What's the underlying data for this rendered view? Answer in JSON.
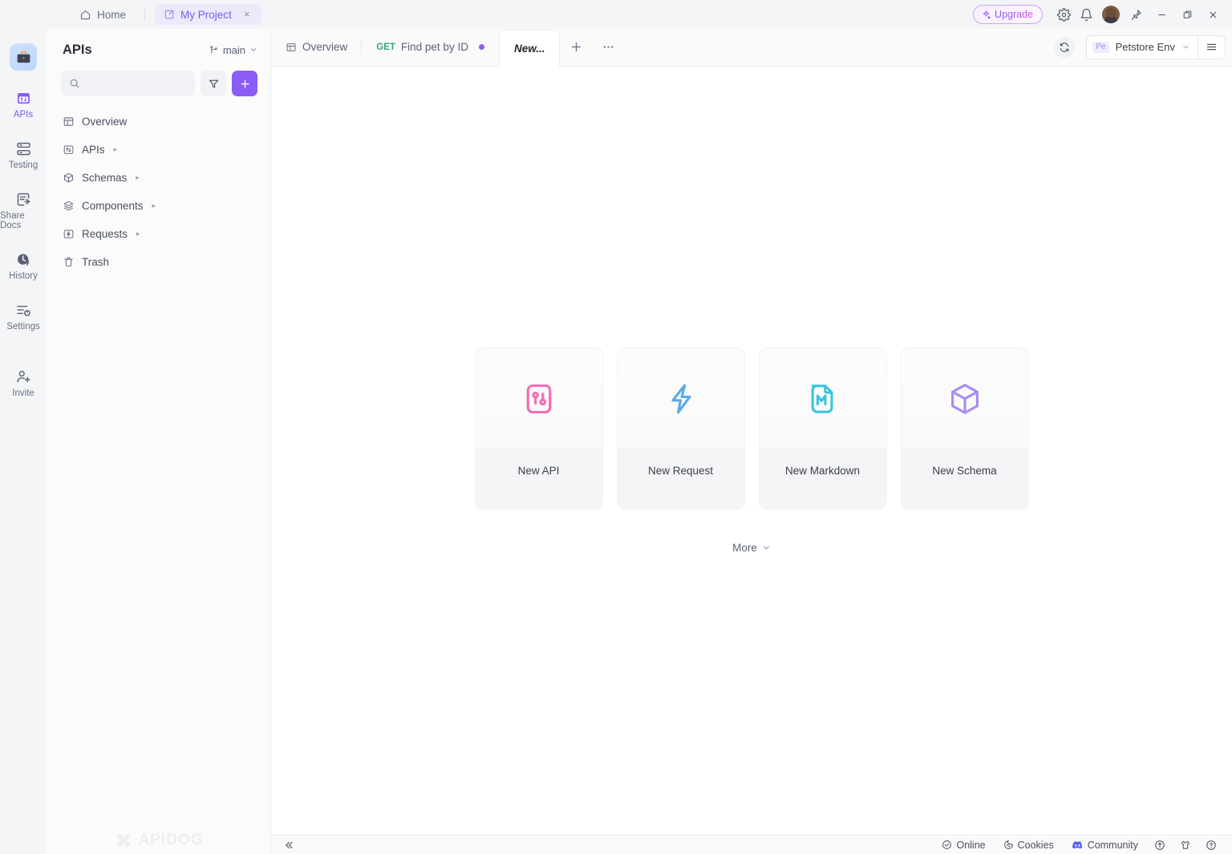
{
  "titlebar": {
    "home_tab": {
      "label": "Home",
      "icon": "home-icon"
    },
    "project_tab": {
      "label": "My Project",
      "icon": "project-icon",
      "close": "×"
    },
    "upgrade": {
      "label": "Upgrade",
      "icon": "sparkle-icon"
    },
    "settings_icon": "gear-icon",
    "notification_icon": "bell-icon",
    "avatar": "user-avatar",
    "pin_icon": "pin-icon",
    "minimize": "−",
    "maximize": "❐",
    "close": "✕"
  },
  "rail": {
    "logo": "briefcase-logo",
    "items": [
      {
        "label": "APIs",
        "icon": "apis-icon",
        "active": true
      },
      {
        "label": "Testing",
        "icon": "testing-icon",
        "active": false
      },
      {
        "label": "Share Docs",
        "icon": "share-docs-icon",
        "active": false
      },
      {
        "label": "History",
        "icon": "history-icon",
        "active": false
      },
      {
        "label": "Settings",
        "icon": "settings-icon",
        "active": false
      },
      {
        "label": "Invite",
        "icon": "invite-icon",
        "active": false
      }
    ]
  },
  "sidebar": {
    "title": "APIs",
    "branch": {
      "label": "main",
      "icon": "branch-icon",
      "chevron": "⌄"
    },
    "search": {
      "value": "",
      "placeholder": "",
      "icon": "search-icon"
    },
    "filter_button": "filter-icon",
    "add_button": "+",
    "tree": [
      {
        "label": "Overview",
        "icon": "overview-icon",
        "expandable": false
      },
      {
        "label": "APIs",
        "icon": "apis-folder-icon",
        "expandable": true
      },
      {
        "label": "Schemas",
        "icon": "schemas-icon",
        "expandable": true
      },
      {
        "label": "Components",
        "icon": "components-icon",
        "expandable": true
      },
      {
        "label": "Requests",
        "icon": "requests-icon",
        "expandable": true
      },
      {
        "label": "Trash",
        "icon": "trash-icon",
        "expandable": false
      }
    ],
    "watermark": "APIDOG"
  },
  "tabstrip": {
    "tabs": [
      {
        "label": "Overview",
        "icon": "overview-tab-icon",
        "method": "",
        "current": false,
        "unsaved": false
      },
      {
        "label": "Find pet by ID",
        "icon": "",
        "method": "GET",
        "current": false,
        "unsaved": true
      },
      {
        "label": "New...",
        "icon": "",
        "method": "",
        "current": true,
        "unsaved": false
      }
    ],
    "new_tab_button": "+",
    "more_button": "⋯",
    "refresh_button": "refresh-icon",
    "environment": {
      "badge": "Pe",
      "name": "Petstore Env",
      "chevron": "⌄"
    },
    "env_menu_button": "hamburger-icon"
  },
  "canvas": {
    "cards": [
      {
        "label": "New API",
        "icon": "new-api-icon",
        "color": "#f56bb4"
      },
      {
        "label": "New Request",
        "icon": "new-request-icon",
        "color": "#5aa9ef"
      },
      {
        "label": "New Markdown",
        "icon": "new-markdown-icon",
        "color": "#3cc3e0"
      },
      {
        "label": "New Schema",
        "icon": "new-schema-icon",
        "color": "#a98cf0"
      }
    ],
    "more": {
      "label": "More",
      "chevron": "⌄"
    }
  },
  "bottombar": {
    "collapse": "«",
    "items": [
      {
        "label": "Online",
        "icon": "status-online-icon"
      },
      {
        "label": "Cookies",
        "icon": "cookie-icon"
      },
      {
        "label": "Community",
        "icon": "discord-icon"
      }
    ],
    "icons": [
      {
        "icon": "upload-circle-icon"
      },
      {
        "icon": "shirt-icon"
      },
      {
        "icon": "help-icon"
      }
    ]
  },
  "colors": {
    "accent": "#8b5cf6",
    "method_get": "#3aa675",
    "rail_bg": "#f4f5f7",
    "sidebar_bg": "#fbfbfc"
  }
}
